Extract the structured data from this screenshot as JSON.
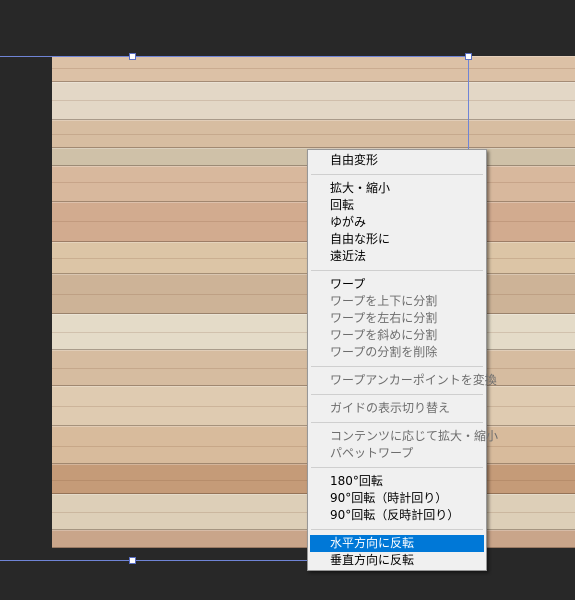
{
  "menu": {
    "items": [
      {
        "id": "free-transform",
        "label": "自由変形",
        "disabled": false
      },
      {
        "id": "scale",
        "label": "拡大・縮小",
        "disabled": false
      },
      {
        "id": "rotate",
        "label": "回転",
        "disabled": false
      },
      {
        "id": "skew",
        "label": "ゆがみ",
        "disabled": false
      },
      {
        "id": "distort",
        "label": "自由な形に",
        "disabled": false
      },
      {
        "id": "perspective",
        "label": "遠近法",
        "disabled": false
      },
      {
        "id": "warp",
        "label": "ワープ",
        "disabled": false
      },
      {
        "id": "split-warp-vertical",
        "label": "ワープを上下に分割",
        "disabled": true
      },
      {
        "id": "split-warp-horizontal",
        "label": "ワープを左右に分割",
        "disabled": true
      },
      {
        "id": "split-warp-crosswise",
        "label": "ワープを斜めに分割",
        "disabled": true
      },
      {
        "id": "remove-warp-split",
        "label": "ワープの分割を削除",
        "disabled": true
      },
      {
        "id": "convert-warp-anchor",
        "label": "ワープアンカーポイントを変換",
        "disabled": true
      },
      {
        "id": "toggle-guides",
        "label": "ガイドの表示切り替え",
        "disabled": true
      },
      {
        "id": "content-aware-scale",
        "label": "コンテンツに応じて拡大・縮小",
        "disabled": true
      },
      {
        "id": "puppet-warp",
        "label": "パペットワープ",
        "disabled": true
      },
      {
        "id": "rotate-180",
        "label": "180°回転",
        "disabled": false
      },
      {
        "id": "rotate-90-cw",
        "label": "90°回転（時計回り）",
        "disabled": false
      },
      {
        "id": "rotate-90-ccw",
        "label": "90°回転（反時計回り）",
        "disabled": false
      },
      {
        "id": "flip-horizontal",
        "label": "水平方向に反転",
        "disabled": false,
        "selected": true
      },
      {
        "id": "flip-vertical",
        "label": "垂直方向に反転",
        "disabled": false
      }
    ]
  },
  "colors": {
    "background": "#282828",
    "menu_bg": "#f0f0f0",
    "highlight": "#0078d7",
    "selection_line": "#6f84d6"
  }
}
